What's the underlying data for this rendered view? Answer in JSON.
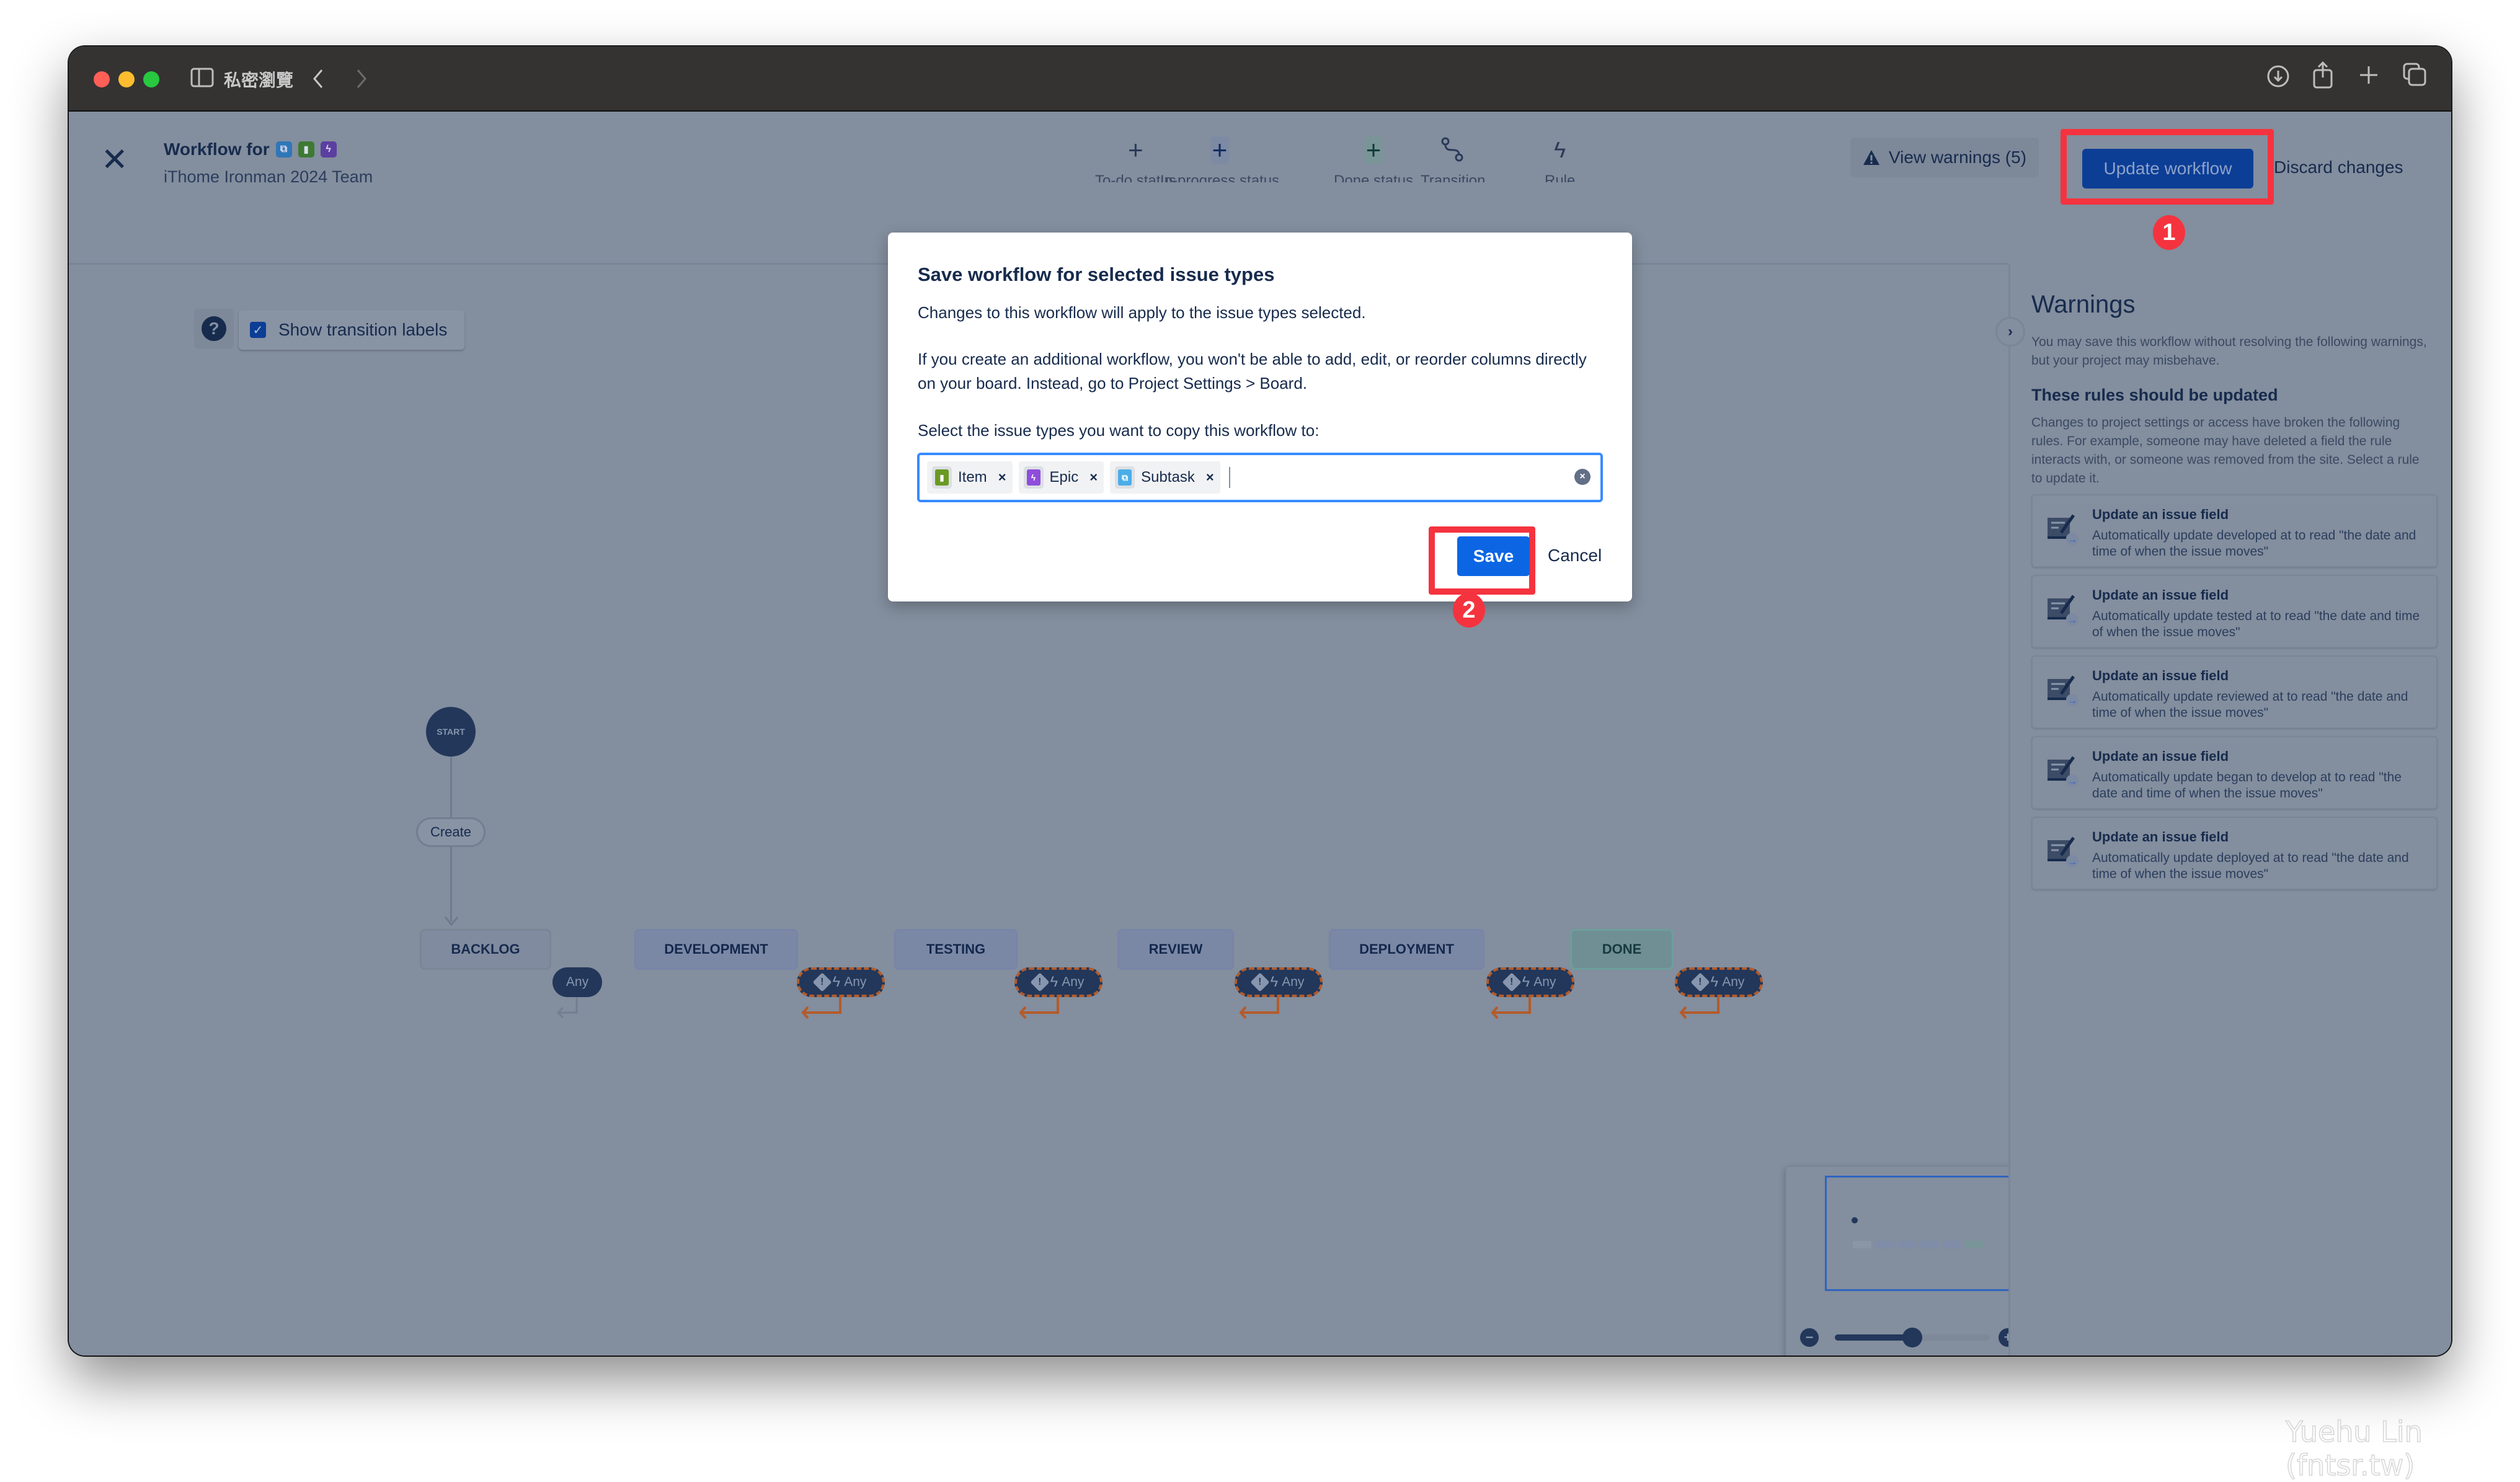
{
  "browser": {
    "window_title": "私密瀏覽",
    "colors": {
      "close": "#fe5f57",
      "minimize": "#febc2e",
      "maximize": "#28c840"
    }
  },
  "header": {
    "title": "Workflow for",
    "subtitle": "iThome Ironman 2024 Team",
    "issue_type_icons": [
      "subtask-icon",
      "item-icon",
      "epic-icon"
    ]
  },
  "toolbar": {
    "items": [
      {
        "label": "To-do status",
        "icon": "plus-icon"
      },
      {
        "label": "In-progress status",
        "icon": "plus-icon"
      },
      {
        "label": "Done status",
        "icon": "plus-icon"
      },
      {
        "label": "Transition",
        "icon": "transition-icon"
      },
      {
        "label": "Rule",
        "icon": "bolt-icon"
      }
    ],
    "view_warnings": "View warnings (5)",
    "update_workflow": "Update workflow",
    "discard_changes": "Discard changes"
  },
  "canvas": {
    "show_transition_labels": "Show transition labels",
    "show_transition_labels_checked": true,
    "start": "START",
    "create_transition": "Create",
    "statuses": [
      {
        "name": "BACKLOG",
        "category": "todo"
      },
      {
        "name": "DEVELOPMENT",
        "category": "inprogress"
      },
      {
        "name": "TESTING",
        "category": "inprogress"
      },
      {
        "name": "REVIEW",
        "category": "inprogress"
      },
      {
        "name": "DEPLOYMENT",
        "category": "inprogress"
      },
      {
        "name": "DONE",
        "category": "done"
      }
    ],
    "any_label": "Any"
  },
  "zoom": {
    "level_fraction": 0.5
  },
  "warnings_panel": {
    "title": "Warnings",
    "intro": "You may save this workflow without resolving the following warnings, but your project may misbehave.",
    "section_title": "These rules should be updated",
    "section_desc": "Changes to project settings or access have broken the following rules. For example, someone may have deleted a field the rule interacts with, or someone was removed from the site. Select a rule to update it.",
    "rules": [
      {
        "title": "Update an issue field",
        "desc": "Automatically update developed at to read \"the date and time of when the issue moves\""
      },
      {
        "title": "Update an issue field",
        "desc": "Automatically update tested at to read \"the date and time of when the issue moves\""
      },
      {
        "title": "Update an issue field",
        "desc": "Automatically update reviewed at to read \"the date and time of when the issue moves\""
      },
      {
        "title": "Update an issue field",
        "desc": "Automatically update began to develop at to read \"the date and time of when the issue moves\""
      },
      {
        "title": "Update an issue field",
        "desc": "Automatically update deployed at to read \"the date and time of when the issue moves\""
      }
    ]
  },
  "dialog": {
    "title": "Save workflow for selected issue types",
    "p1": "Changes to this workflow will apply to the issue types selected.",
    "p2": "If you create an additional workflow, you won't be able to add, edit, or reorder columns directly on your board. Instead, go to Project Settings > Board.",
    "p3": "Select the issue types you want to copy this workflow to:",
    "selected_types": [
      {
        "label": "Item",
        "color": "#6a9a23",
        "icon": "item-icon"
      },
      {
        "label": "Epic",
        "color": "#8f4ddb",
        "icon": "epic-icon"
      },
      {
        "label": "Subtask",
        "color": "#4bade8",
        "icon": "subtask-icon"
      }
    ],
    "save": "Save",
    "cancel": "Cancel"
  },
  "annotations": {
    "step1": "1",
    "step2": "2",
    "color": "#f5333f"
  },
  "watermark": "Yuehu Lin (fntsr.tw)"
}
